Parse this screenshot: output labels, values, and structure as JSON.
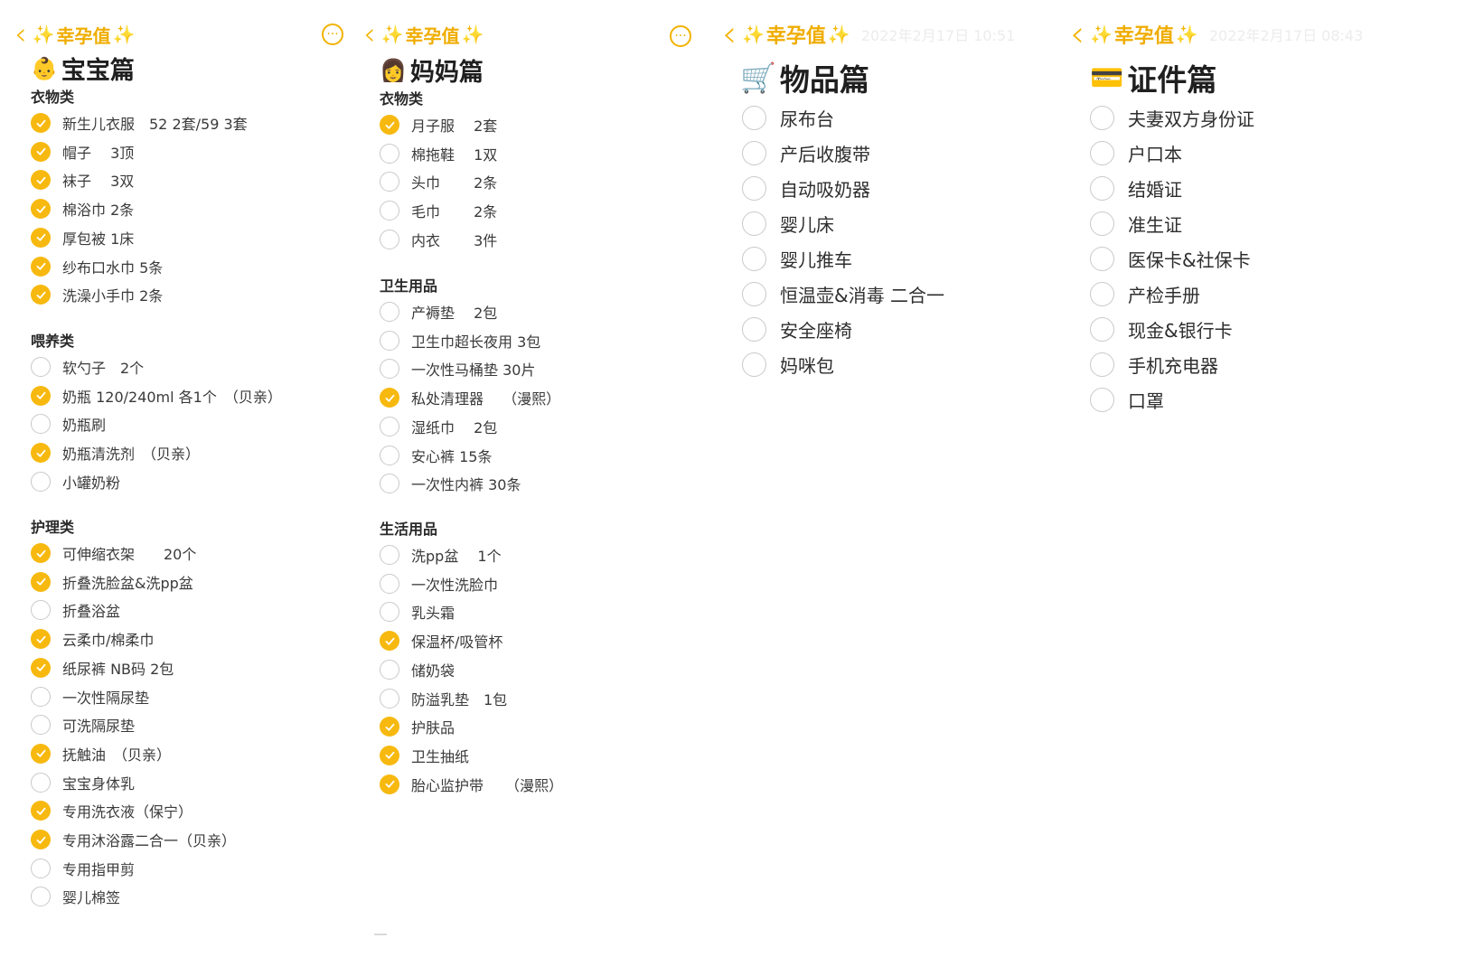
{
  "accent_color": "#f7b90f",
  "back_icon": "chevron-left-icon",
  "more_icon": "more-circle-icon",
  "nav_title": "幸孕值",
  "panels": [
    {
      "title": "宝宝篇",
      "emoji": "👶",
      "categories": [
        {
          "name": "衣物类",
          "items": [
            {
              "label": "新生儿衣服　52 2套/59 3套",
              "checked": true
            },
            {
              "label": "帽子　 3顶",
              "checked": true
            },
            {
              "label": "袜子　 3双",
              "checked": true
            },
            {
              "label": "棉浴巾  2条",
              "checked": true
            },
            {
              "label": "厚包被  1床",
              "checked": true
            },
            {
              "label": "纱布口水巾  5条",
              "checked": true
            },
            {
              "label": "洗澡小手巾  2条",
              "checked": true
            }
          ]
        },
        {
          "name": "喂养类",
          "items": [
            {
              "label": "软勺子　2个",
              "checked": false
            },
            {
              "label": "奶瓶 120/240ml 各1个　（贝亲）",
              "checked": true
            },
            {
              "label": "奶瓶刷",
              "checked": false
            },
            {
              "label": "奶瓶清洗剂　（贝亲）",
              "checked": true
            },
            {
              "label": "小罐奶粉",
              "checked": false
            }
          ]
        },
        {
          "name": "护理类",
          "items": [
            {
              "label": "可伸缩衣架　　20个",
              "checked": true
            },
            {
              "label": "折叠洗脸盆&洗pp盆",
              "checked": true
            },
            {
              "label": "折叠浴盆",
              "checked": false
            },
            {
              "label": "云柔巾/棉柔巾",
              "checked": true
            },
            {
              "label": "纸尿裤  NB码 2包",
              "checked": true
            },
            {
              "label": "一次性隔尿垫",
              "checked": false
            },
            {
              "label": "可洗隔尿垫",
              "checked": false
            },
            {
              "label": "抚触油　（贝亲）",
              "checked": true
            },
            {
              "label": "宝宝身体乳",
              "checked": false
            },
            {
              "label": "专用洗衣液（保宁）",
              "checked": true
            },
            {
              "label": "专用沐浴露二合一（贝亲）",
              "checked": true
            },
            {
              "label": "专用指甲剪",
              "checked": false
            },
            {
              "label": "婴儿棉签",
              "checked": false
            }
          ]
        }
      ]
    },
    {
      "title": "妈妈篇",
      "emoji": "👩",
      "categories": [
        {
          "name": "衣物类",
          "items": [
            {
              "label": "月子服　 2套",
              "checked": true
            },
            {
              "label": "棉拖鞋　 1双",
              "checked": false
            },
            {
              "label": "头巾　　 2条",
              "checked": false
            },
            {
              "label": "毛巾　　 2条",
              "checked": false
            },
            {
              "label": "内衣　　 3件",
              "checked": false
            }
          ]
        },
        {
          "name": "卫生用品",
          "items": [
            {
              "label": "产褥垫　 2包",
              "checked": false
            },
            {
              "label": "卫生巾超长夜用  3包",
              "checked": false
            },
            {
              "label": "一次性马桶垫  30片",
              "checked": false
            },
            {
              "label": "私处清理器　 （漫熙）",
              "checked": true
            },
            {
              "label": "湿纸巾　 2包",
              "checked": false
            },
            {
              "label": "安心裤  15条",
              "checked": false
            },
            {
              "label": "一次性内裤 30条",
              "checked": false
            }
          ]
        },
        {
          "name": "生活用品",
          "items": [
            {
              "label": "洗pp盆　 1个",
              "checked": false
            },
            {
              "label": "一次性洗脸巾",
              "checked": false
            },
            {
              "label": "乳头霜",
              "checked": false
            },
            {
              "label": "保温杯/吸管杯",
              "checked": true
            },
            {
              "label": "储奶袋",
              "checked": false
            },
            {
              "label": "防溢乳垫　1包",
              "checked": false
            },
            {
              "label": "护肤品",
              "checked": true
            },
            {
              "label": "卫生抽纸",
              "checked": true
            },
            {
              "label": "胎心监护带　　（漫熙）",
              "checked": true
            }
          ]
        }
      ]
    },
    {
      "title": "物品篇",
      "emoji": "🛒",
      "timestamp": "2022年2月17日 10:51",
      "items": [
        {
          "label": "尿布台",
          "checked": false
        },
        {
          "label": "产后收腹带",
          "checked": false
        },
        {
          "label": "自动吸奶器",
          "checked": false
        },
        {
          "label": "婴儿床",
          "checked": false
        },
        {
          "label": "婴儿推车",
          "checked": false
        },
        {
          "label": "恒温壶&消毒 二合一",
          "checked": false
        },
        {
          "label": "安全座椅",
          "checked": false
        },
        {
          "label": "妈咪包",
          "checked": false
        }
      ]
    },
    {
      "title": "证件篇",
      "emoji": "💳",
      "timestamp": "2022年2月17日 08:43",
      "items": [
        {
          "label": "夫妻双方身份证",
          "checked": false
        },
        {
          "label": "户口本",
          "checked": false
        },
        {
          "label": "结婚证",
          "checked": false
        },
        {
          "label": "准生证",
          "checked": false
        },
        {
          "label": "医保卡&社保卡",
          "checked": false
        },
        {
          "label": "产检手册",
          "checked": false
        },
        {
          "label": "现金&银行卡",
          "checked": false
        },
        {
          "label": "手机充电器",
          "checked": false
        },
        {
          "label": "口罩",
          "checked": false
        }
      ]
    }
  ]
}
